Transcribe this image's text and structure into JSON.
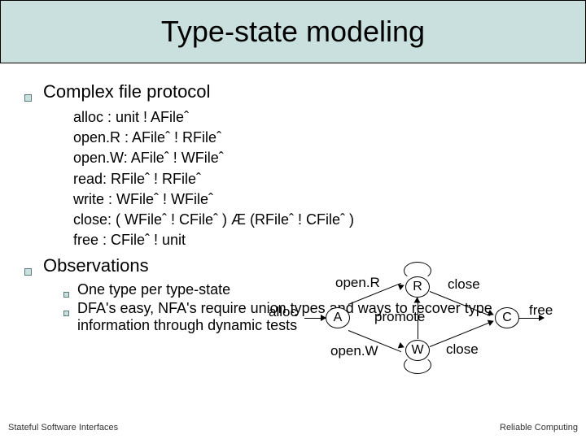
{
  "title": "Type-state modeling",
  "section1": "Complex file protocol",
  "protocol": [
    "alloc : unit ! AFileˆ",
    "open.R     : AFileˆ ! RFileˆ",
    "open.W: AFileˆ ! WFileˆ",
    "read: RFileˆ ! RFileˆ",
    "write     : WFileˆ ! WFileˆ",
    "close: ( WFileˆ ! CFileˆ ) Æ (RFileˆ ! CFileˆ )",
    "free : CFileˆ ! unit"
  ],
  "section2": "Observations",
  "obs": [
    "One type per type-state",
    "DFA's easy, NFA's require union types and ways to recover type information through dynamic tests"
  ],
  "diagram": {
    "nodes": {
      "A": "A",
      "R": "R",
      "W": "W",
      "C": "C"
    },
    "labels": {
      "alloc": "alloc",
      "openR": "open.R",
      "openW": "open.W",
      "promote": "promote",
      "closeR": "close",
      "closeW": "close",
      "free": "free"
    }
  },
  "footer": {
    "left": "Stateful Software Interfaces",
    "right": "Reliable Computing"
  }
}
